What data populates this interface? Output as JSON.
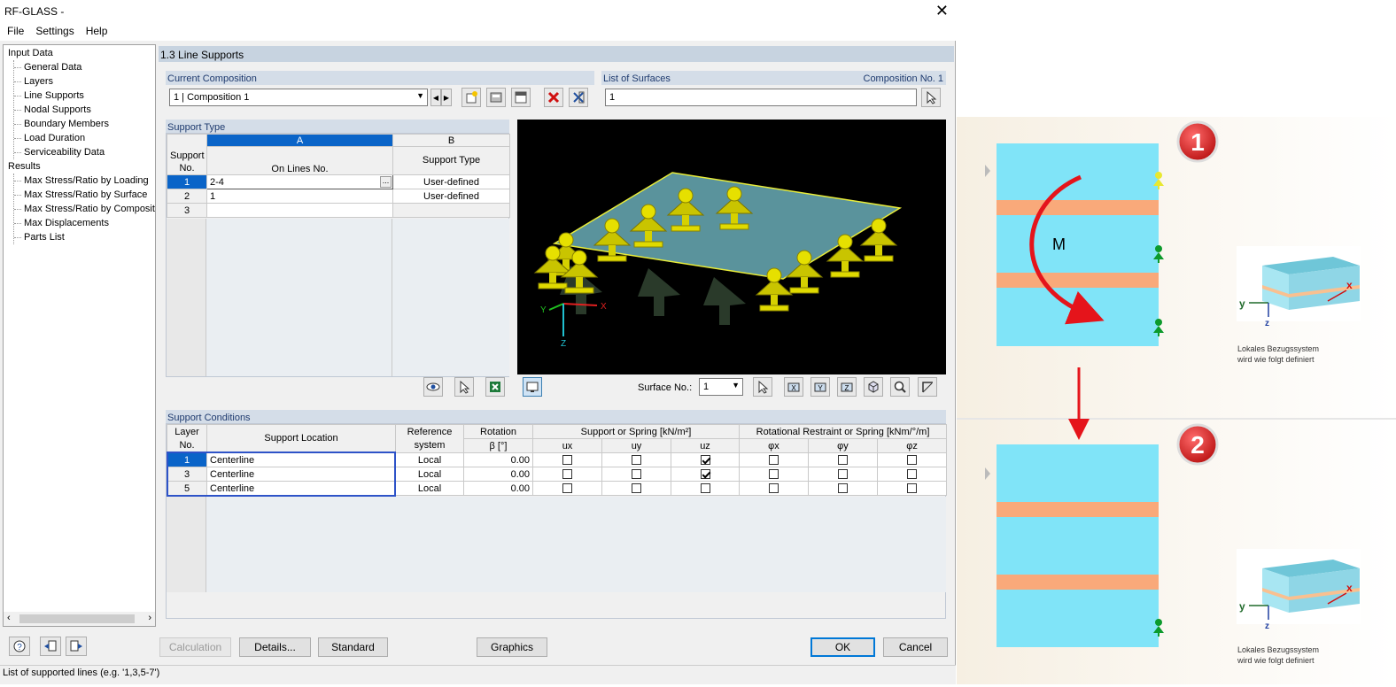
{
  "window": {
    "title": "RF-GLASS -",
    "close_glyph": "✕"
  },
  "menu": [
    "File",
    "Settings",
    "Help"
  ],
  "tree": {
    "input_label": "Input Data",
    "input_items": [
      "General Data",
      "Layers",
      "Line Supports",
      "Nodal Supports",
      "Boundary Members",
      "Load Duration",
      "Serviceability Data"
    ],
    "results_label": "Results",
    "result_items": [
      "Max Stress/Ratio by Loading",
      "Max Stress/Ratio by Surface",
      "Max Stress/Ratio by Composition",
      "Max Displacements",
      "Parts List"
    ]
  },
  "page_title": "1.3 Line Supports",
  "current_composition": {
    "label": "Current Composition",
    "value": "1 | Composition 1"
  },
  "surfaces": {
    "label": "List of Surfaces",
    "composition_no": "Composition No. 1",
    "value": "1"
  },
  "support_type": {
    "label": "Support Type",
    "col_letters": [
      "A",
      "B"
    ],
    "headers": [
      "Support No.",
      "On Lines No.",
      "Support Type"
    ],
    "rows": [
      {
        "no": "1",
        "lines": "2-4",
        "type": "User-defined"
      },
      {
        "no": "2",
        "lines": "1",
        "type": "User-defined"
      },
      {
        "no": "3",
        "lines": "",
        "type": ""
      }
    ]
  },
  "viewer": {
    "surface_label": "Surface No.:",
    "surface_value": "1",
    "axis_x": "X",
    "axis_y": "Y",
    "axis_z": "Z"
  },
  "support_conditions": {
    "label": "Support Conditions",
    "h_layer": "Layer No.",
    "h_location": "Support Location",
    "h_ref": "Reference system",
    "h_rot": "Rotation",
    "h_rot2": "β [°]",
    "h_spring": "Support or Spring [kN/m²]",
    "h_rotspring": "Rotational Restraint or Spring [kNm/°/m]",
    "sub": [
      "ux",
      "uy",
      "uz",
      "φx",
      "φy",
      "φz"
    ],
    "rows": [
      {
        "layer": "1",
        "loc": "Centerline",
        "ref": "Local",
        "rot": "0.00",
        "checks": [
          false,
          false,
          true,
          false,
          false,
          false
        ]
      },
      {
        "layer": "3",
        "loc": "Centerline",
        "ref": "Local",
        "rot": "0.00",
        "checks": [
          false,
          false,
          true,
          false,
          false,
          false
        ]
      },
      {
        "layer": "5",
        "loc": "Centerline",
        "ref": "Local",
        "rot": "0.00",
        "checks": [
          false,
          false,
          false,
          false,
          false,
          false
        ]
      }
    ]
  },
  "buttons": {
    "calculation": "Calculation",
    "details": "Details...",
    "standard": "Standard",
    "graphics": "Graphics",
    "ok": "OK",
    "cancel": "Cancel"
  },
  "status": "List of supported lines (e.g. '1,3,5-7')",
  "right_panel": {
    "moment_label": "M",
    "badge1": "1",
    "badge2": "2",
    "caption1": "Lokales Bezugssystem",
    "caption2": "wird wie folgt definiert",
    "axis_x": "x",
    "axis_y": "y",
    "axis_z": "z"
  },
  "colors": {
    "accent": "#0a64c8",
    "glass": "#80e4f8",
    "interlayer": "#f9a97a",
    "support_green": "#0c9a2c",
    "arrow_red": "#e5141b"
  }
}
